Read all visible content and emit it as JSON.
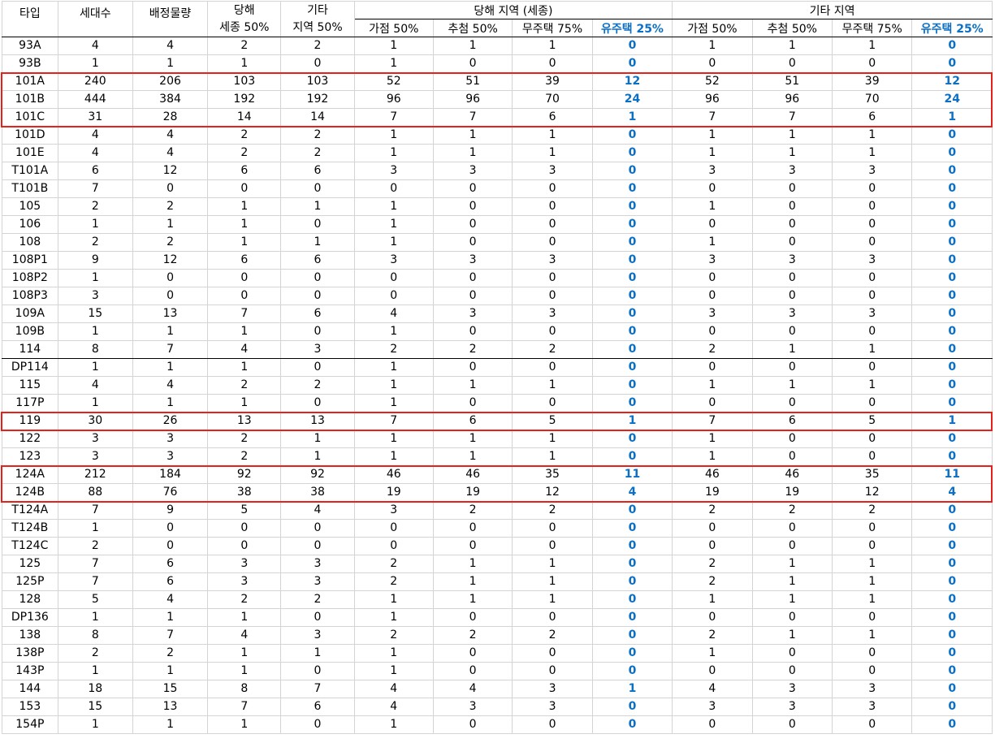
{
  "headers": {
    "type": "타입",
    "households": "세대수",
    "allocation": "배정물량",
    "local_sejong_line1": "당해",
    "local_sejong_line2": "세종 50%",
    "other_region_line1": "기타",
    "other_region_line2": "지역 50%",
    "local_group": "당해 지역 (세종)",
    "other_group": "기타 지역",
    "points": "가점 50%",
    "lottery": "추첨 50%",
    "no_house": "무주택 75%",
    "has_house": "유주택 25%"
  },
  "colors": {
    "highlight_border": "#e8201a",
    "blue_text": "#0b6fc4"
  },
  "rows": [
    [
      "93A",
      "4",
      "4",
      "2",
      "2",
      "1",
      "1",
      "1",
      "0",
      "1",
      "1",
      "1",
      "0"
    ],
    [
      "93B",
      "1",
      "1",
      "1",
      "0",
      "1",
      "0",
      "0",
      "0",
      "0",
      "0",
      "0",
      "0"
    ],
    [
      "101A",
      "240",
      "206",
      "103",
      "103",
      "52",
      "51",
      "39",
      "12",
      "52",
      "51",
      "39",
      "12"
    ],
    [
      "101B",
      "444",
      "384",
      "192",
      "192",
      "96",
      "96",
      "70",
      "24",
      "96",
      "96",
      "70",
      "24"
    ],
    [
      "101C",
      "31",
      "28",
      "14",
      "14",
      "7",
      "7",
      "6",
      "1",
      "7",
      "7",
      "6",
      "1"
    ],
    [
      "101D",
      "4",
      "4",
      "2",
      "2",
      "1",
      "1",
      "1",
      "0",
      "1",
      "1",
      "1",
      "0"
    ],
    [
      "101E",
      "4",
      "4",
      "2",
      "2",
      "1",
      "1",
      "1",
      "0",
      "1",
      "1",
      "1",
      "0"
    ],
    [
      "T101A",
      "6",
      "12",
      "6",
      "6",
      "3",
      "3",
      "3",
      "0",
      "3",
      "3",
      "3",
      "0"
    ],
    [
      "T101B",
      "7",
      "0",
      "0",
      "0",
      "0",
      "0",
      "0",
      "0",
      "0",
      "0",
      "0",
      "0"
    ],
    [
      "105",
      "2",
      "2",
      "1",
      "1",
      "1",
      "0",
      "0",
      "0",
      "1",
      "0",
      "0",
      "0"
    ],
    [
      "106",
      "1",
      "1",
      "1",
      "0",
      "1",
      "0",
      "0",
      "0",
      "0",
      "0",
      "0",
      "0"
    ],
    [
      "108",
      "2",
      "2",
      "1",
      "1",
      "1",
      "0",
      "0",
      "0",
      "1",
      "0",
      "0",
      "0"
    ],
    [
      "108P1",
      "9",
      "12",
      "6",
      "6",
      "3",
      "3",
      "3",
      "0",
      "3",
      "3",
      "3",
      "0"
    ],
    [
      "108P2",
      "1",
      "0",
      "0",
      "0",
      "0",
      "0",
      "0",
      "0",
      "0",
      "0",
      "0",
      "0"
    ],
    [
      "108P3",
      "3",
      "0",
      "0",
      "0",
      "0",
      "0",
      "0",
      "0",
      "0",
      "0",
      "0",
      "0"
    ],
    [
      "109A",
      "15",
      "13",
      "7",
      "6",
      "4",
      "3",
      "3",
      "0",
      "3",
      "3",
      "3",
      "0"
    ],
    [
      "109B",
      "1",
      "1",
      "1",
      "0",
      "1",
      "0",
      "0",
      "0",
      "0",
      "0",
      "0",
      "0"
    ],
    [
      "114",
      "8",
      "7",
      "4",
      "3",
      "2",
      "2",
      "2",
      "0",
      "2",
      "1",
      "1",
      "0"
    ],
    [
      "DP114",
      "1",
      "1",
      "1",
      "0",
      "1",
      "0",
      "0",
      "0",
      "0",
      "0",
      "0",
      "0"
    ],
    [
      "115",
      "4",
      "4",
      "2",
      "2",
      "1",
      "1",
      "1",
      "0",
      "1",
      "1",
      "1",
      "0"
    ],
    [
      "117P",
      "1",
      "1",
      "1",
      "0",
      "1",
      "0",
      "0",
      "0",
      "0",
      "0",
      "0",
      "0"
    ],
    [
      "119",
      "30",
      "26",
      "13",
      "13",
      "7",
      "6",
      "5",
      "1",
      "7",
      "6",
      "5",
      "1"
    ],
    [
      "122",
      "3",
      "3",
      "2",
      "1",
      "1",
      "1",
      "1",
      "0",
      "1",
      "0",
      "0",
      "0"
    ],
    [
      "123",
      "3",
      "3",
      "2",
      "1",
      "1",
      "1",
      "1",
      "0",
      "1",
      "0",
      "0",
      "0"
    ],
    [
      "124A",
      "212",
      "184",
      "92",
      "92",
      "46",
      "46",
      "35",
      "11",
      "46",
      "46",
      "35",
      "11"
    ],
    [
      "124B",
      "88",
      "76",
      "38",
      "38",
      "19",
      "19",
      "12",
      "4",
      "19",
      "19",
      "12",
      "4"
    ],
    [
      "T124A",
      "7",
      "9",
      "5",
      "4",
      "3",
      "2",
      "2",
      "0",
      "2",
      "2",
      "2",
      "0"
    ],
    [
      "T124B",
      "1",
      "0",
      "0",
      "0",
      "0",
      "0",
      "0",
      "0",
      "0",
      "0",
      "0",
      "0"
    ],
    [
      "T124C",
      "2",
      "0",
      "0",
      "0",
      "0",
      "0",
      "0",
      "0",
      "0",
      "0",
      "0",
      "0"
    ],
    [
      "125",
      "7",
      "6",
      "3",
      "3",
      "2",
      "1",
      "1",
      "0",
      "2",
      "1",
      "1",
      "0"
    ],
    [
      "125P",
      "7",
      "6",
      "3",
      "3",
      "2",
      "1",
      "1",
      "0",
      "2",
      "1",
      "1",
      "0"
    ],
    [
      "128",
      "5",
      "4",
      "2",
      "2",
      "1",
      "1",
      "1",
      "0",
      "1",
      "1",
      "1",
      "0"
    ],
    [
      "DP136",
      "1",
      "1",
      "1",
      "0",
      "1",
      "0",
      "0",
      "0",
      "0",
      "0",
      "0",
      "0"
    ],
    [
      "138",
      "8",
      "7",
      "4",
      "3",
      "2",
      "2",
      "2",
      "0",
      "2",
      "1",
      "1",
      "0"
    ],
    [
      "138P",
      "2",
      "2",
      "1",
      "1",
      "1",
      "0",
      "0",
      "0",
      "1",
      "0",
      "0",
      "0"
    ],
    [
      "143P",
      "1",
      "1",
      "1",
      "0",
      "1",
      "0",
      "0",
      "0",
      "0",
      "0",
      "0",
      "0"
    ],
    [
      "144",
      "18",
      "15",
      "8",
      "7",
      "4",
      "4",
      "3",
      "1",
      "4",
      "3",
      "3",
      "0"
    ],
    [
      "153",
      "15",
      "13",
      "7",
      "6",
      "4",
      "3",
      "3",
      "0",
      "3",
      "3",
      "3",
      "0"
    ],
    [
      "154P",
      "1",
      "1",
      "1",
      "0",
      "1",
      "0",
      "0",
      "0",
      "0",
      "0",
      "0",
      "0"
    ]
  ],
  "highlight_groups": [
    [
      "101A",
      "101B",
      "101C"
    ],
    [
      "119"
    ],
    [
      "124A",
      "124B"
    ]
  ]
}
